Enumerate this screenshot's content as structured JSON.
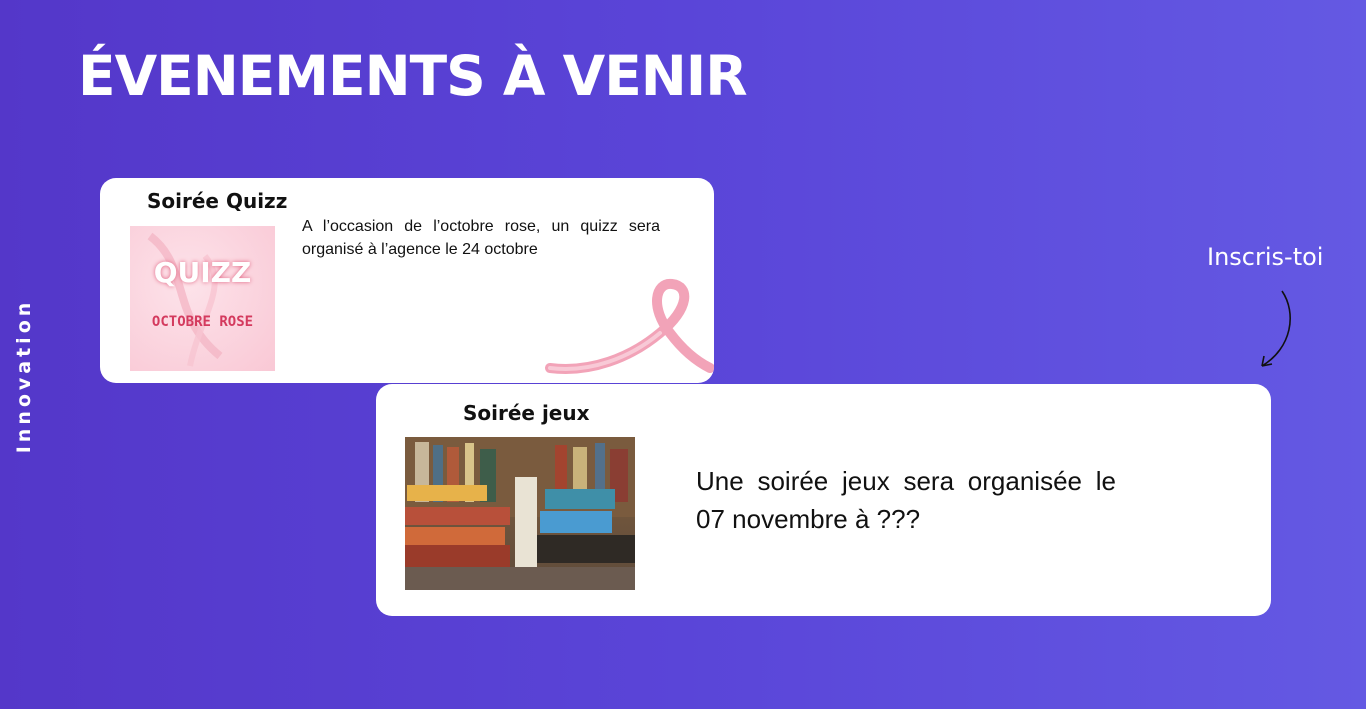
{
  "header": {
    "title": "ÉVENEMENTS À VENIR"
  },
  "side": {
    "label": "Innovation"
  },
  "events": [
    {
      "title": "Soirée Quizz",
      "description": "A l’occasion de l’octobre rose, un quizz sera organisé à l’agence le 24 octobre",
      "image": {
        "main_text": "QUIZZ",
        "sub_text": "OCTOBRE ROSE"
      }
    },
    {
      "title": "Soirée jeux",
      "description": "Une soirée jeux sera organisée le 07 novembre à ???"
    }
  ],
  "cta": {
    "label": "Inscris-toi"
  },
  "colors": {
    "background_start": "#5437c9",
    "background_end": "#6459e3",
    "card": "#ffffff",
    "ribbon": "#f2a3b8"
  }
}
